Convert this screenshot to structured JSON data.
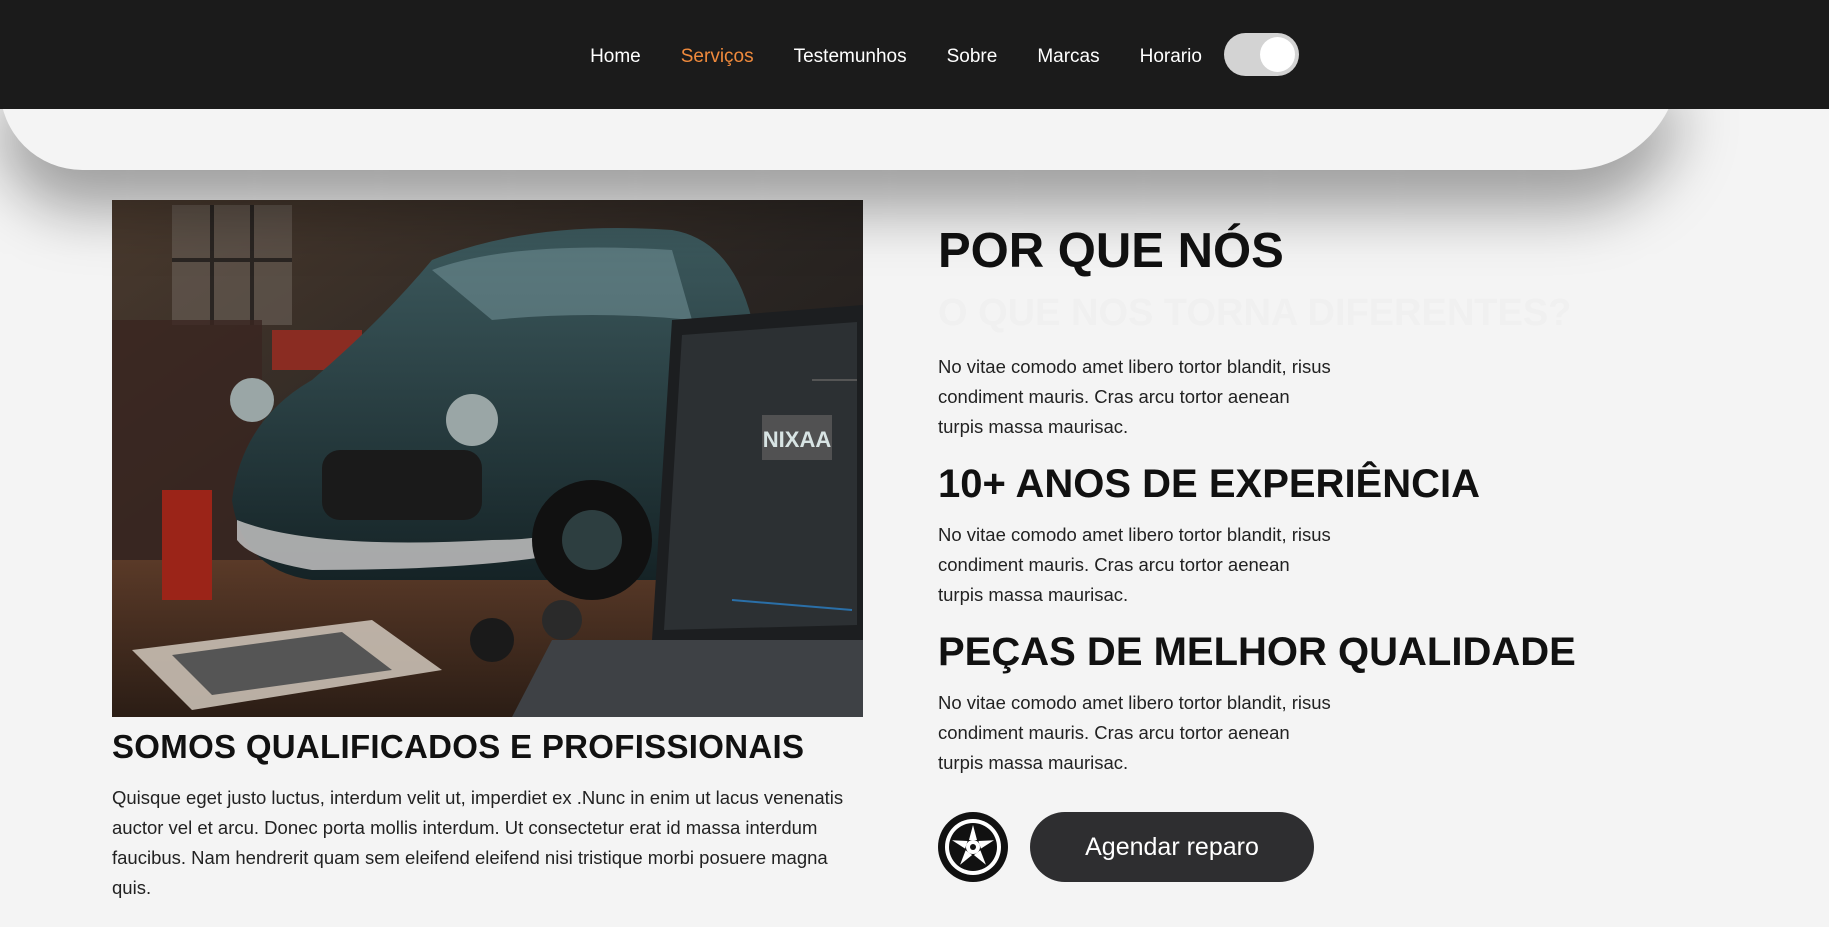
{
  "nav": {
    "items": [
      {
        "label": "Home",
        "active": false
      },
      {
        "label": "Serviços",
        "active": true
      },
      {
        "label": "Testemunhos",
        "active": false
      },
      {
        "label": "Sobre",
        "active": false
      },
      {
        "label": "Marcas",
        "active": false
      },
      {
        "label": "Horario",
        "active": false
      }
    ],
    "theme_toggle": {
      "icon": "toggle-switch",
      "state": "on"
    },
    "accent_color": "#f08a3c"
  },
  "hero_image": {
    "icon": "vintage-car-garage-photo",
    "screen_logo": "NIXAA"
  },
  "left": {
    "title": "SOMOS QUALIFICADOS E PROFISSIONAIS",
    "text": "Quisque eget justo luctus, interdum velit ut, imperdiet ex .Nunc in enim ut lacus venenatis auctor vel et arcu. Donec porta mollis interdum. Ut consectetur erat id massa interdum faucibus. Nam hendrerit quam sem eleifend eleifend nisi tristique morbi posuere magna quis."
  },
  "right": {
    "title": "POR QUE NÓS",
    "subtitle": "O QUE NOS TORNA DIFERENTES?",
    "intro": "No vitae comodo amet libero tortor blandit, risus condiment mauris. Cras arcu tortor aenean turpis massa maurisac.",
    "sections": [
      {
        "heading": "10+ ANOS DE EXPERIÊNCIA",
        "text": "No vitae comodo amet libero tortor blandit, risus condiment mauris. Cras arcu tortor aenean turpis massa maurisac."
      },
      {
        "heading": "PEÇAS DE MELHOR QUALIDADE",
        "text": "No vitae comodo amet libero tortor blandit, risus condiment mauris. Cras arcu tortor aenean turpis massa maurisac."
      }
    ],
    "cta": {
      "label": "Agendar reparo",
      "icon": "wheel-rim-icon"
    }
  }
}
